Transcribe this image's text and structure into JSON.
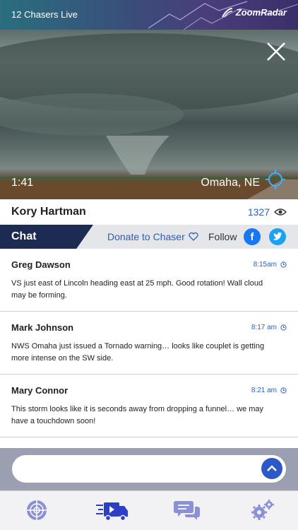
{
  "header": {
    "title": "12 Chasers Live",
    "brand": "ZoomRadar"
  },
  "video": {
    "elapsed": "1:41",
    "location": "Omaha, NE"
  },
  "chaser": {
    "name": "Kory Hartman",
    "viewers": "1327"
  },
  "chatbar": {
    "chat_label": "Chat",
    "donate_label": "Donate to Chaser",
    "follow_label": "Follow",
    "facebook_letter": "f"
  },
  "messages": [
    {
      "author": "Greg Dawson",
      "time": "8:15am",
      "text": "VS just east of Lincoln heading east at 25 mph. Good rotation! Wall cloud may be forming."
    },
    {
      "author": "Mark Johnson",
      "time": "8:17 am",
      "text": "NWS Omaha just issued a Tornado warning… looks like couplet is getting more intense on the SW side."
    },
    {
      "author": "Mary Connor",
      "time": "8:21 am",
      "text": "This storm looks like it is seconds away from dropping a funnel… we may have a touchdown soon!"
    }
  ],
  "composer": {
    "placeholder": "",
    "value": ""
  },
  "nav": [
    "radar-target",
    "live-video",
    "chat",
    "settings"
  ],
  "colors": {
    "accent": "#2c5fb8",
    "chat_tab": "#1d2a52",
    "nav_icon": "#8b8fd6",
    "nav_active": "#2d3fc4"
  }
}
